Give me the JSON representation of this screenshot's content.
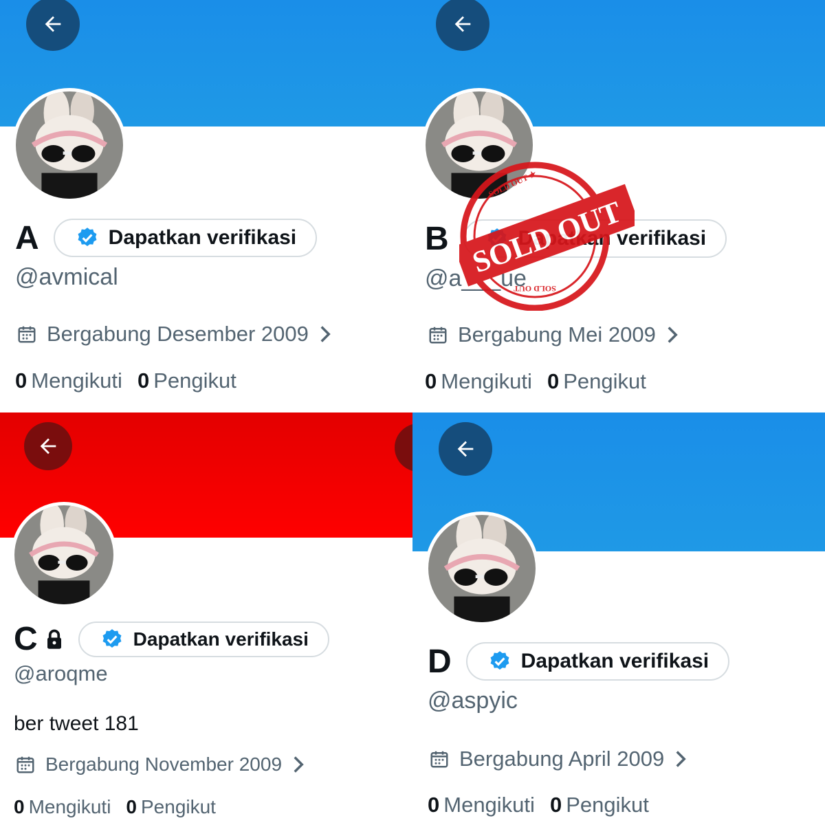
{
  "panels": [
    {
      "id": "a",
      "name": "A",
      "handle": "@avmical",
      "joined": "Bergabung Desember 2009",
      "following_count": "0",
      "following_label": "Mengikuti",
      "followers_count": "0",
      "followers_label": "Pengikut",
      "verify_label": "Dapatkan verifikasi",
      "banner_color": "#1d95e8"
    },
    {
      "id": "b",
      "name": "B",
      "handle": "@a___ue",
      "joined": "Bergabung Mei 2009",
      "following_count": "0",
      "following_label": "Mengikuti",
      "followers_count": "0",
      "followers_label": "Pengikut",
      "verify_label": "Dapatkan verifikasi",
      "banner_color": "#1d95e8",
      "stamp_text": "SOLD OUT"
    },
    {
      "id": "c",
      "name": "C",
      "handle": "@aroqme",
      "bio": "ber tweet 181",
      "joined": "Bergabung November 2009",
      "following_count": "0",
      "following_label": "Mengikuti",
      "followers_count": "0",
      "followers_label": "Pengikut",
      "verify_label": "Dapatkan verifikasi",
      "banner_color": "#ff0000",
      "protected": true
    },
    {
      "id": "d",
      "name": "D",
      "handle": "@aspyic",
      "joined": "Bergabung April 2009",
      "following_count": "0",
      "following_label": "Mengikuti",
      "followers_count": "0",
      "followers_label": "Pengikut",
      "verify_label": "Dapatkan verifikasi",
      "banner_color": "#1d95e8"
    }
  ],
  "icons": {
    "back": "arrow-left-icon",
    "verified": "verified-badge-icon",
    "calendar": "calendar-icon",
    "chevron": "chevron-right-icon",
    "lock": "lock-icon"
  },
  "colors": {
    "accent": "#1d9bf0",
    "stamp": "#d7161b"
  }
}
